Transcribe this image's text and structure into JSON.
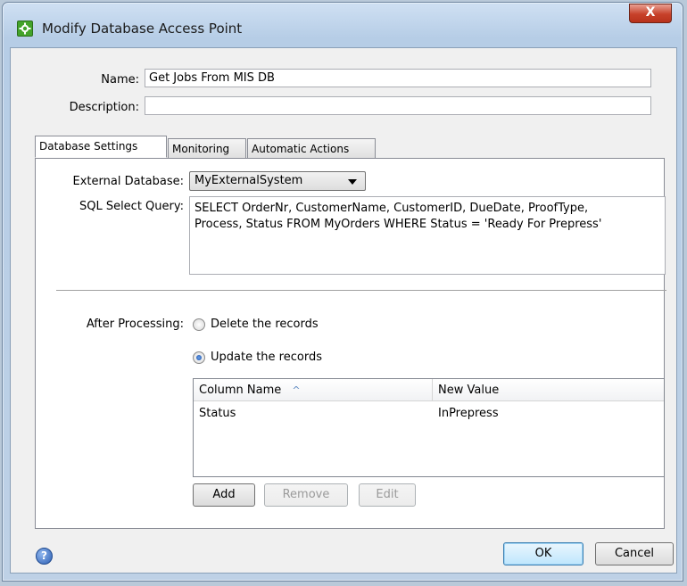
{
  "window": {
    "title": "Modify Database Access Point",
    "close_glyph": "X"
  },
  "form": {
    "name_label": "Name:",
    "name_value": "Get Jobs From MIS DB",
    "description_label": "Description:",
    "description_value": ""
  },
  "tabs": [
    {
      "label": "Database Settings",
      "active": true
    },
    {
      "label": "Monitoring",
      "active": false
    },
    {
      "label": "Automatic Actions",
      "active": false
    }
  ],
  "database": {
    "external_label": "External Database:",
    "external_value": "MyExternalSystem",
    "sql_label": "SQL Select Query:",
    "sql_line1": "SELECT OrderNr, CustomerName, CustomerID, DueDate, ProofType,",
    "sql_line2": "Process, Status FROM MyOrders WHERE Status = 'Ready For Prepress'"
  },
  "after_processing": {
    "label": "After Processing:",
    "option_delete": "Delete the records",
    "option_update": "Update the records",
    "selected": "update"
  },
  "table": {
    "headers": [
      "Column Name",
      "New Value"
    ],
    "sort_indicator": "^",
    "rows": [
      [
        "Status",
        "InPrepress"
      ]
    ]
  },
  "table_buttons": {
    "add": "Add",
    "remove": "Remove",
    "edit": "Edit"
  },
  "footer": {
    "help_glyph": "?",
    "ok": "OK",
    "cancel": "Cancel"
  },
  "icons": {
    "app": "green-gear-icon",
    "help": "help-icon",
    "dropdown": "chevron-down-icon",
    "sort": "sort-ascending-icon"
  },
  "colors": {
    "title_bar": "#b6cde6",
    "close_button": "#c7412a",
    "default_button": "#bee6fd"
  }
}
